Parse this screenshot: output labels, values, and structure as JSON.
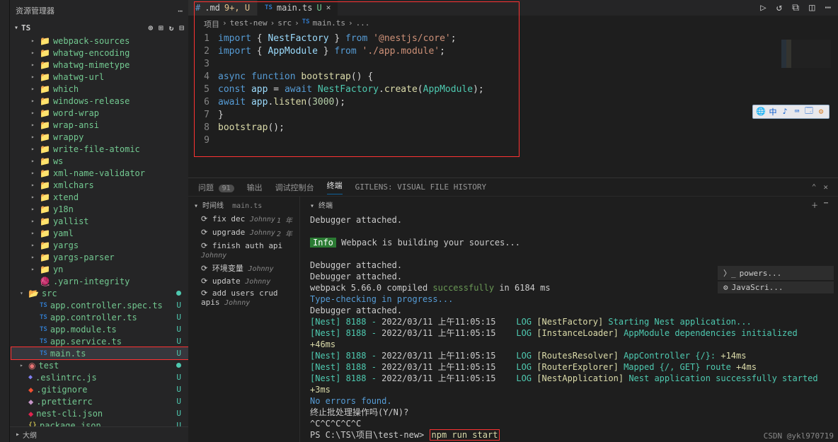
{
  "sidebar": {
    "title": "资源管理器",
    "section": "TS",
    "folders": [
      "webpack-sources",
      "whatwg-encoding",
      "whatwg-mimetype",
      "whatwg-url",
      "which",
      "windows-release",
      "word-wrap",
      "wrap-ansi",
      "wrappy",
      "write-file-atomic",
      "ws",
      "xml-name-validator",
      "xmlchars",
      "xtend",
      "y18n",
      "yallist",
      "yaml",
      "yargs",
      "yargs-parser",
      "yn"
    ],
    "yarn_integrity": ".yarn-integrity",
    "src": "src",
    "src_files": [
      "app.controller.spec.ts",
      "app.controller.ts",
      "app.module.ts",
      "app.service.ts",
      "main.ts"
    ],
    "test": "test",
    "root_files": [
      ".eslintrc.js",
      ".gitignore",
      ".prettierrc",
      "nest-cli.json",
      "package.json"
    ],
    "outline": "大纲"
  },
  "tabs": {
    "t1_name": ".md",
    "t1_badge": "9+, U",
    "t2_name": "main.ts",
    "t2_badge": "U"
  },
  "tab_icons": {
    "readme_prefix": "#",
    "ts_prefix": "TS"
  },
  "breadcrumb": [
    "项目",
    "test-new",
    "src",
    "main.ts",
    "..."
  ],
  "breadcrumb_icon": "TS",
  "code": {
    "lines": [
      "1",
      "2",
      "3",
      "4",
      "5",
      "6",
      "7",
      "8",
      "9"
    ],
    "l1_import": "import",
    "l1_b1": " { ",
    "l1_NestFactory": "NestFactory",
    "l1_b2": " } ",
    "l1_from": "from",
    "l1_str": "'@nestjs/core'",
    "l1_end": ";",
    "l2_import": "import",
    "l2_b1": " { ",
    "l2_AppModule": "AppModule",
    "l2_b2": " } ",
    "l2_from": "from",
    "l2_str": "'./app.module'",
    "l2_end": ";",
    "l4_async": "async",
    "l4_function": " function ",
    "l4_boot": "bootstrap",
    "l4_paren": "() {",
    "l5_const": "  const ",
    "l5_app": "app",
    "l5_eq": " = ",
    "l5_await": "await ",
    "l5_NF": "NestFactory",
    "l5_dot": ".",
    "l5_create": "create",
    "l5_open": "(",
    "l5_AM": "AppModule",
    "l5_close": ");",
    "l6_await": "  await ",
    "l6_app": "app",
    "l6_dot": ".",
    "l6_listen": "listen",
    "l6_open": "(",
    "l6_port": "3000",
    "l6_close": ");",
    "l7": "}",
    "l8_boot": "bootstrap",
    "l8_call": "();"
  },
  "panel": {
    "tabs": [
      "问题",
      "输出",
      "调试控制台",
      "终端"
    ],
    "count": "91",
    "ext": "GITLENS: VISUAL FILE HISTORY"
  },
  "timeline": {
    "title": "时间线",
    "file": "main.ts",
    "items": [
      {
        "t": "fix dec",
        "who": "Johnny",
        "when": "1 年"
      },
      {
        "t": "upgrade",
        "who": "Johnny",
        "when": "2 年"
      },
      {
        "t": "finish auth api",
        "who": "Johnny",
        "when": ""
      },
      {
        "t": "环境变量",
        "who": "Johnny",
        "when": ""
      },
      {
        "t": "update",
        "who": "Johnny",
        "when": ""
      },
      {
        "t": "add users crud apis",
        "who": "Johnny",
        "when": ""
      }
    ]
  },
  "terminal": {
    "title": "终端",
    "attached": "Debugger attached.",
    "info_label": "Info",
    "info_text": " Webpack is building your sources...",
    "compiled_1": "webpack 5.66.0 compiled ",
    "compiled_success": "successfully",
    "compiled_2": " in 6184 ms",
    "typecheck": "Type-checking in progress...",
    "nest_prefix": "[Nest] 8188  - ",
    "timestamp": "2022/03/11 上午11:05:15",
    "log": "LOG",
    "n1_tag": "[NestFactory]",
    "n1_msg": " Starting Nest application...",
    "n2_tag": "[InstanceLoader]",
    "n2_msg": " AppModule dependencies initialized ",
    "n2_t": "+46ms",
    "n3_tag": "[RoutesResolver]",
    "n3_msg": " AppController {/}: ",
    "n3_t": "+14ms",
    "n4_tag": "[RouterExplorer]",
    "n4_msg": " Mapped {/, GET} route ",
    "n4_t": "+4ms",
    "n5_tag": "[NestApplication]",
    "n5_msg": " Nest application successfully started ",
    "n5_t": "+3ms",
    "noerr": "No errors found.",
    "stop": "终止批处理操作吗(Y/N)?",
    "ctl": "^C^C^C^C^C",
    "prompt": "PS C:\\TS\\项目\\test-new> ",
    "cmd": "npm run start"
  },
  "floating": [
    "🌐",
    "中",
    "♪",
    "⌨",
    "🗔",
    "⚙"
  ],
  "rightbar": [
    "powers...",
    "JavaScri..."
  ],
  "watermark": "CSDN @ykl970719"
}
